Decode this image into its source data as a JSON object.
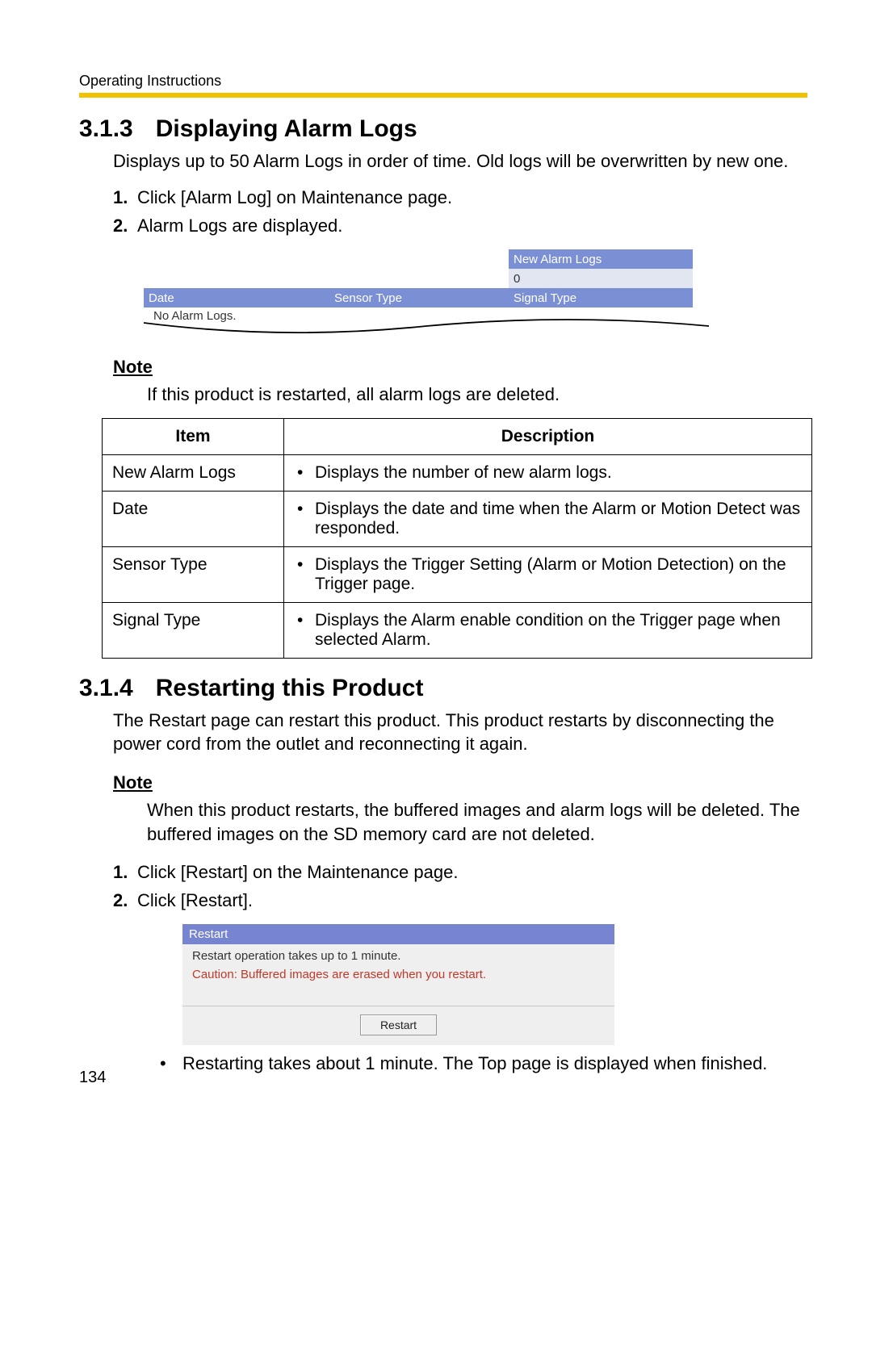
{
  "header": {
    "label": "Operating Instructions"
  },
  "section1": {
    "number": "3.1.3",
    "title": "Displaying Alarm Logs",
    "intro": "Displays up to 50 Alarm Logs in order of time. Old logs will be overwritten by new one.",
    "steps": [
      "Click [Alarm Log] on Maintenance page.",
      "Alarm Logs are displayed."
    ],
    "alarm_shot": {
      "new_alarm_label": "New Alarm Logs",
      "new_alarm_count": "0",
      "cols": {
        "date": "Date",
        "sensor": "Sensor Type",
        "signal": "Signal Type"
      },
      "empty": "No Alarm Logs."
    },
    "note_heading": "Note",
    "note_text": "If this product is restarted, all alarm logs are deleted.",
    "table": {
      "head_item": "Item",
      "head_desc": "Description",
      "rows": [
        {
          "item": "New Alarm Logs",
          "desc": "Displays the number of new alarm logs."
        },
        {
          "item": "Date",
          "desc": "Displays the date and time when the Alarm or Motion Detect was responded."
        },
        {
          "item": "Sensor Type",
          "desc": "Displays the Trigger Setting (Alarm or Motion Detection) on the Trigger page."
        },
        {
          "item": "Signal Type",
          "desc": "Displays the Alarm enable condition on the Trigger page when selected Alarm."
        }
      ]
    }
  },
  "section2": {
    "number": "3.1.4",
    "title": "Restarting this Product",
    "intro": "The Restart page can restart this product. This product restarts by disconnecting the power cord from the outlet and reconnecting it again.",
    "note_heading": "Note",
    "note_text": "When this product restarts, the buffered images and alarm logs will be deleted. The buffered images on the SD memory card are not deleted.",
    "steps": [
      "Click [Restart] on the Maintenance page.",
      "Click [Restart]."
    ],
    "restart_shot": {
      "header": "Restart",
      "msg": "Restart operation takes up to 1 minute.",
      "caution": "Caution: Buffered images are erased when you restart.",
      "button": "Restart"
    },
    "bullet": "Restarting takes about 1 minute. The Top page is displayed when finished."
  },
  "page_number": "134"
}
